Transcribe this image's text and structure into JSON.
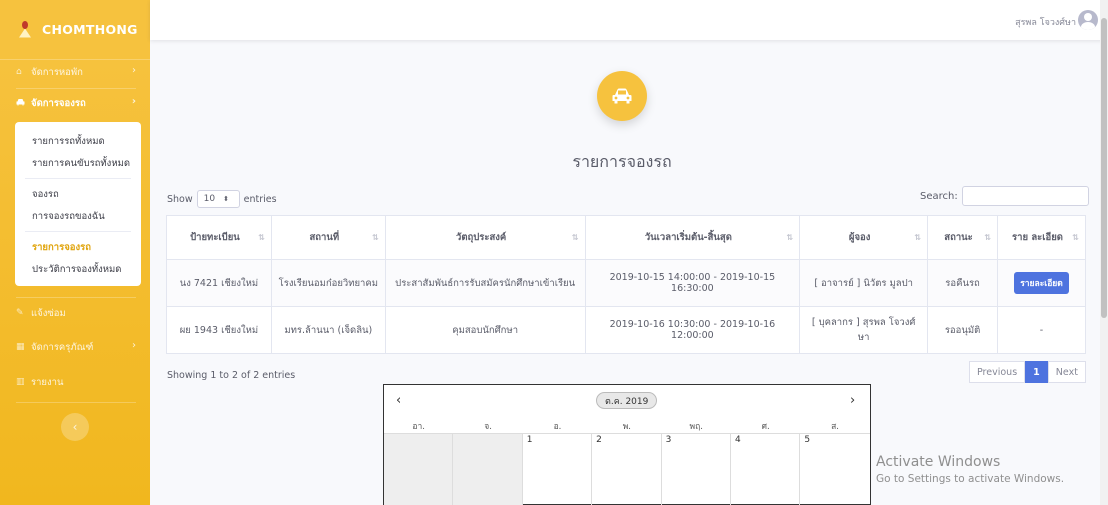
{
  "brand": {
    "name": "CHOMTHONG"
  },
  "sidebar": {
    "items": [
      {
        "label": "จัดการหอพัก",
        "icon": "house-icon",
        "has_chevron": true
      },
      {
        "label": "จัดการจองรถ",
        "icon": "car-icon",
        "has_chevron": true,
        "active": true
      },
      {
        "label": "แจ้งซ่อม",
        "icon": "wrench-icon",
        "has_chevron": false
      },
      {
        "label": "จัดการครุภัณฑ์",
        "icon": "table-icon",
        "has_chevron": true
      },
      {
        "label": "รายงาน",
        "icon": "chart-icon",
        "has_chevron": false
      }
    ],
    "submenu": [
      {
        "label": "รายการรถทั้งหมด"
      },
      {
        "label": "รายการคนขับรถทั้งหมด"
      },
      {
        "label": "จองรถ"
      },
      {
        "label": "การจองรถของฉัน"
      },
      {
        "label": "รายการจองรถ",
        "current": true
      },
      {
        "label": "ประวัติการจองทั้งหมด"
      }
    ],
    "toggle_icon": "chevron-left-icon"
  },
  "topbar": {
    "user_name": "สุรพล โจวงศ์ษา"
  },
  "page": {
    "title": "รายการจองรถ",
    "icon": "car-icon"
  },
  "table_controls": {
    "show_label": "Show",
    "entries_value": "10",
    "entries_label": "entries",
    "search_label": "Search:",
    "search_value": ""
  },
  "table": {
    "columns": [
      "ป้ายทะเบียน",
      "สถานที่",
      "วัตถุประสงค์",
      "วันเวลาเริ่มต้น-สิ้นสุด",
      "ผู้จอง",
      "สถานะ",
      "ราย ละเอียด"
    ],
    "rows": [
      {
        "plate": "นง 7421 เชียงใหม่",
        "place": "โรงเรียนอมก๋อยวิทยาคม",
        "purpose": "ประสาสัมพันธ์การรับสมัครนักศึกษาเข้าเรียน",
        "datetime": "2019-10-15 14:00:00 - 2019-10-15 16:30:00",
        "booker": "[ อาจารย์ ] นิวัตร มูลปา",
        "status": "รอคืนรถ",
        "detail": "รายละเอียด"
      },
      {
        "plate": "ผย 1943 เชียงใหม่",
        "place": "มทร.ล้านนา (เจ็ดลิน)",
        "purpose": "คุมสอบนักศึกษา",
        "datetime": "2019-10-16 10:30:00 - 2019-10-16 12:00:00",
        "booker": "[ บุคลากร ] สุรพล โจวงศ์ษา",
        "status": "รออนุมัติ",
        "detail": "-"
      }
    ]
  },
  "footer": {
    "showing": "Showing 1 to 2 of 2 entries",
    "previous": "Previous",
    "page": "1",
    "next": "Next"
  },
  "calendar": {
    "month_label": "ต.ค. 2019",
    "prev": "‹",
    "next": "›",
    "weekdays": [
      "อา.",
      "จ.",
      "อ.",
      "พ.",
      "พฤ.",
      "ศ.",
      "ส."
    ],
    "first_week": [
      "",
      "",
      "1",
      "2",
      "3",
      "4",
      "5"
    ]
  },
  "watermark": {
    "line1": "Activate Windows",
    "line2": "Go to Settings to activate Windows."
  }
}
